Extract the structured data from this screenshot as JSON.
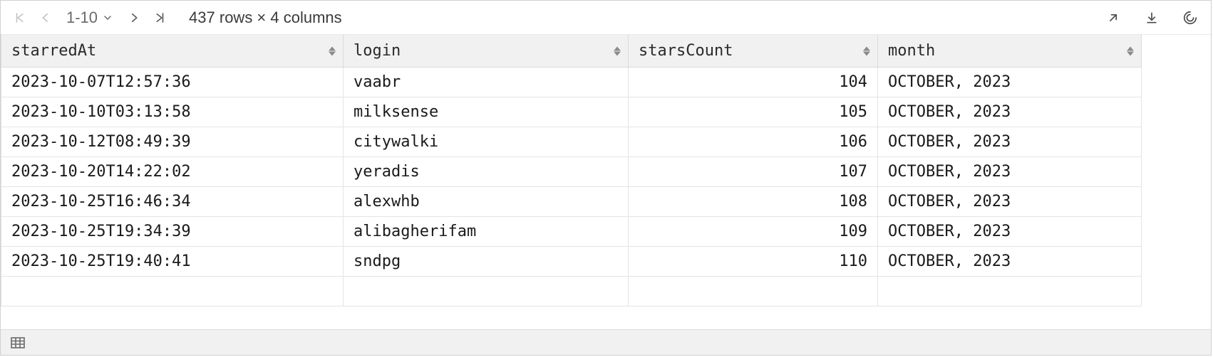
{
  "toolbar": {
    "page_range": "1-10",
    "summary": "437 rows × 4 columns"
  },
  "columns": [
    {
      "key": "starredAt",
      "label": "starredAt",
      "align": "left"
    },
    {
      "key": "login",
      "label": "login",
      "align": "left"
    },
    {
      "key": "starsCount",
      "label": "starsCount",
      "align": "right"
    },
    {
      "key": "month",
      "label": "month",
      "align": "left"
    }
  ],
  "rows": [
    {
      "starredAt": "2023-10-07T12:57:36",
      "login": "vaabr",
      "starsCount": "104",
      "month": "OCTOBER, 2023"
    },
    {
      "starredAt": "2023-10-10T03:13:58",
      "login": "milksense",
      "starsCount": "105",
      "month": "OCTOBER, 2023"
    },
    {
      "starredAt": "2023-10-12T08:49:39",
      "login": "citywalki",
      "starsCount": "106",
      "month": "OCTOBER, 2023"
    },
    {
      "starredAt": "2023-10-20T14:22:02",
      "login": "yeradis",
      "starsCount": "107",
      "month": "OCTOBER, 2023"
    },
    {
      "starredAt": "2023-10-25T16:46:34",
      "login": "alexwhb",
      "starsCount": "108",
      "month": "OCTOBER, 2023"
    },
    {
      "starredAt": "2023-10-25T19:34:39",
      "login": "alibagherifam",
      "starsCount": "109",
      "month": "OCTOBER, 2023"
    },
    {
      "starredAt": "2023-10-25T19:40:41",
      "login": "sndpg",
      "starsCount": "110",
      "month": "OCTOBER, 2023"
    }
  ]
}
